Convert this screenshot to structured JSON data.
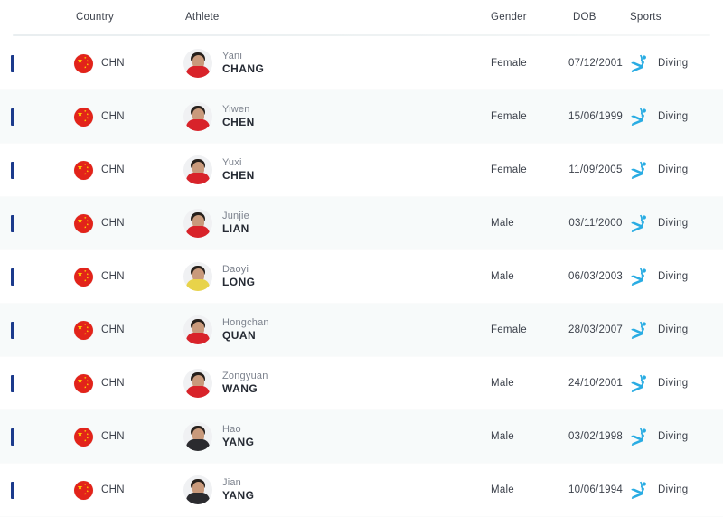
{
  "table": {
    "columns": [
      {
        "key": "country",
        "label": "Country"
      },
      {
        "key": "athlete",
        "label": "Athlete"
      },
      {
        "key": "gender",
        "label": "Gender"
      },
      {
        "key": "dob",
        "label": "DOB"
      },
      {
        "key": "sports",
        "label": "Sports"
      }
    ],
    "rows": [
      {
        "country": "CHN",
        "flag": "flag-china-icon",
        "given_name": "Yani",
        "family_name": "CHANG",
        "gender": "Female",
        "dob": "07/12/2001",
        "sport": "Diving",
        "sport_icon": "diving-pictogram-icon",
        "jersey": "red"
      },
      {
        "country": "CHN",
        "flag": "flag-china-icon",
        "given_name": "Yiwen",
        "family_name": "CHEN",
        "gender": "Female",
        "dob": "15/06/1999",
        "sport": "Diving",
        "sport_icon": "diving-pictogram-icon",
        "jersey": "red"
      },
      {
        "country": "CHN",
        "flag": "flag-china-icon",
        "given_name": "Yuxi",
        "family_name": "CHEN",
        "gender": "Female",
        "dob": "11/09/2005",
        "sport": "Diving",
        "sport_icon": "diving-pictogram-icon",
        "jersey": "red"
      },
      {
        "country": "CHN",
        "flag": "flag-china-icon",
        "given_name": "Junjie",
        "family_name": "LIAN",
        "gender": "Male",
        "dob": "03/11/2000",
        "sport": "Diving",
        "sport_icon": "diving-pictogram-icon",
        "jersey": "red"
      },
      {
        "country": "CHN",
        "flag": "flag-china-icon",
        "given_name": "Daoyi",
        "family_name": "LONG",
        "gender": "Male",
        "dob": "06/03/2003",
        "sport": "Diving",
        "sport_icon": "diving-pictogram-icon",
        "jersey": "yellow"
      },
      {
        "country": "CHN",
        "flag": "flag-china-icon",
        "given_name": "Hongchan",
        "family_name": "QUAN",
        "gender": "Female",
        "dob": "28/03/2007",
        "sport": "Diving",
        "sport_icon": "diving-pictogram-icon",
        "jersey": "red"
      },
      {
        "country": "CHN",
        "flag": "flag-china-icon",
        "given_name": "Zongyuan",
        "family_name": "WANG",
        "gender": "Male",
        "dob": "24/10/2001",
        "sport": "Diving",
        "sport_icon": "diving-pictogram-icon",
        "jersey": "red"
      },
      {
        "country": "CHN",
        "flag": "flag-china-icon",
        "given_name": "Hao",
        "family_name": "YANG",
        "gender": "Male",
        "dob": "03/02/1998",
        "sport": "Diving",
        "sport_icon": "diving-pictogram-icon",
        "jersey": "dark"
      },
      {
        "country": "CHN",
        "flag": "flag-china-icon",
        "given_name": "Jian",
        "family_name": "YANG",
        "gender": "Male",
        "dob": "10/06/1994",
        "sport": "Diving",
        "sport_icon": "diving-pictogram-icon",
        "jersey": "dark"
      }
    ]
  },
  "colors": {
    "accent_bar": "#1b3a8c",
    "sport_icon": "#29ace3",
    "flag_red": "#e2231a",
    "flag_star": "#ffde00",
    "row_alt_background": "#f7fafa",
    "row_background": "#ffffff",
    "text_primary": "#262b34",
    "text_secondary": "#7c828d"
  }
}
